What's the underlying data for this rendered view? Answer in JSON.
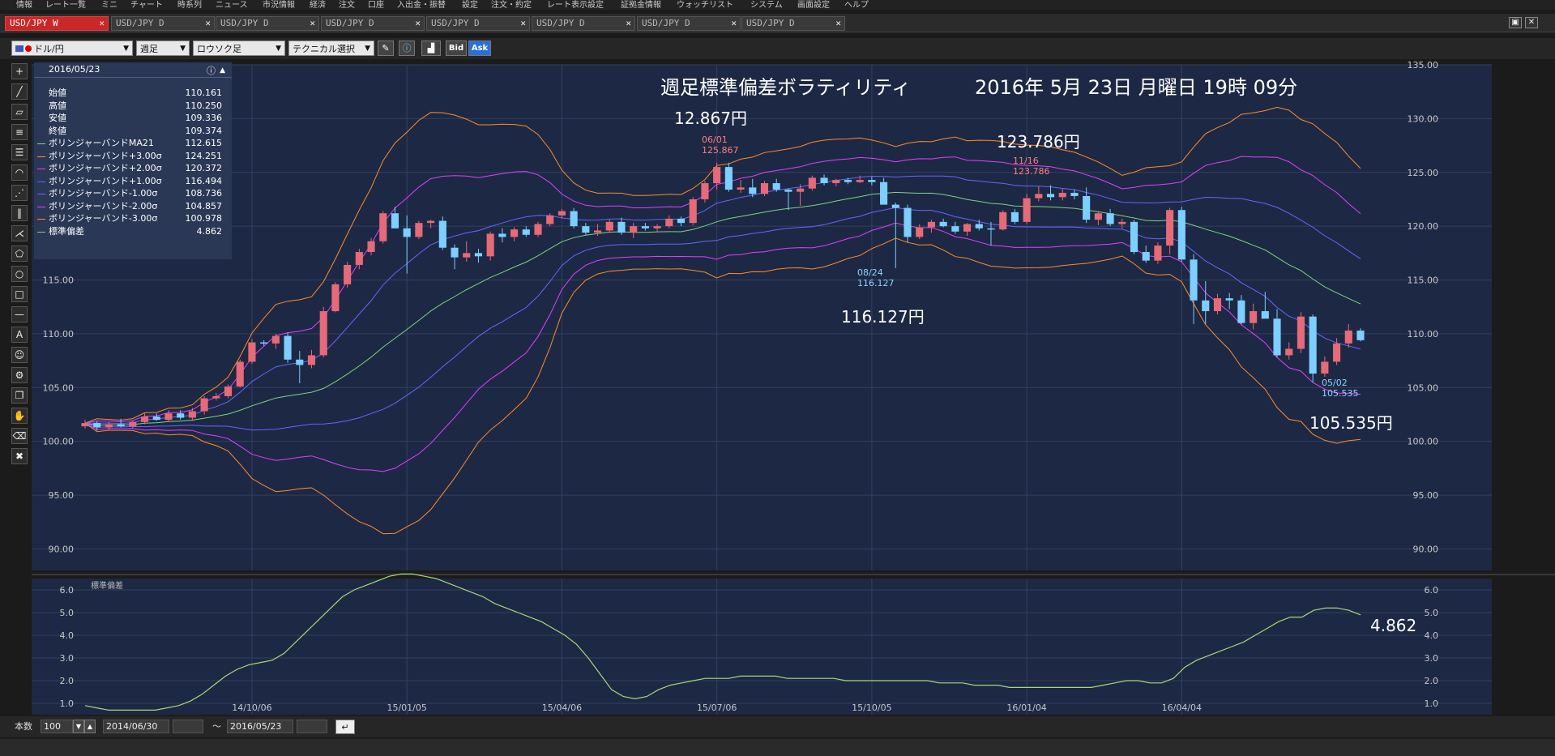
{
  "menu": [
    "情報",
    "レート一覧",
    "ミニ",
    "チャート",
    "時系列",
    "ニュース",
    "市況情報",
    "経済",
    "注文",
    "口座",
    "入出金・振替",
    "設定",
    "注文・約定",
    "レート表示設定",
    "証拠金情報",
    "ウォッチリスト",
    "システム",
    "画面設定",
    "ヘルプ"
  ],
  "tabs": [
    {
      "label": "USD/JPY W",
      "active": true
    },
    {
      "label": "USD/JPY D"
    },
    {
      "label": "USD/JPY D"
    },
    {
      "label": "USD/JPY D"
    },
    {
      "label": "USD/JPY D"
    },
    {
      "label": "USD/JPY D"
    },
    {
      "label": "USD/JPY D"
    },
    {
      "label": "USD/JPY D"
    }
  ],
  "toolbar": {
    "currency": "ドル/円",
    "period": "週足",
    "chart_type": "ロウソク足",
    "technical": "テクニカル選択",
    "bid": "Bid",
    "ask": "Ask"
  },
  "info": {
    "date": "2016/05/23",
    "rows": [
      {
        "label": "始値",
        "value": "110.161",
        "color": ""
      },
      {
        "label": "高値",
        "value": "110.250",
        "color": ""
      },
      {
        "label": "安値",
        "value": "109.336",
        "color": ""
      },
      {
        "label": "終値",
        "value": "109.374",
        "color": ""
      },
      {
        "label": "ボリンジャーバンドMA21",
        "value": "112.615",
        "color": "#7dd47d"
      },
      {
        "label": "ボリンジャーバンド+3.00σ",
        "value": "124.251",
        "color": "#ff8c28"
      },
      {
        "label": "ボリンジャーバンド+2.00σ",
        "value": "120.372",
        "color": "#e040ff"
      },
      {
        "label": "ボリンジャーバンド+1.00σ",
        "value": "116.494",
        "color": "#6666ff"
      },
      {
        "label": "ボリンジャーバンド-1.00σ",
        "value": "108.736",
        "color": "#6666ff"
      },
      {
        "label": "ボリンジャーバンド-2.00σ",
        "value": "104.857",
        "color": "#e040ff"
      },
      {
        "label": "ボリンジャーバンド-3.00σ",
        "value": "100.978",
        "color": "#ff8c28"
      },
      {
        "label": "標準偏差",
        "value": "4.862",
        "color": "#aaaaaa"
      }
    ]
  },
  "annotations": {
    "title": "週足標準偏差ボラティリティ",
    "timestamp": "2016年 5月 23日 月曜日 19時 09分",
    "high1": "12.867円",
    "high1_date": "06/01",
    "high1_val": "125.867",
    "high2": "123.786円",
    "high2_date": "11/16",
    "high2_val": "123.786",
    "low1": "116.127円",
    "low1_date": "08/24",
    "low1_val": "116.127",
    "low2": "105.535円",
    "low2_date": "05/02",
    "low2_val": "105.535",
    "sd_last": "4.862",
    "sd_panel_label": "標準偏差"
  },
  "bottom": {
    "count_label": "本数",
    "count": "100",
    "from": "2014/06/30",
    "tilde": "〜",
    "to": "2016/05/23"
  },
  "chart_data": [
    {
      "type": "candlestick",
      "ylim": [
        88,
        135
      ],
      "y_ticks": [
        "135.00",
        "130.00",
        "125.00",
        "120.00",
        "115.00",
        "110.00",
        "105.00",
        "100.00",
        "95.00",
        "90.00"
      ],
      "x_ticks": [
        "14/10/06",
        "15/01/05",
        "15/04/06",
        "15/07/06",
        "15/10/05",
        "16/01/04",
        "16/04/04"
      ],
      "bullish_color": "#e66a78",
      "bearish_color": "#7ccfff",
      "candles": [
        [
          101.4,
          102.0,
          101.2,
          101.7
        ],
        [
          101.7,
          101.9,
          101.0,
          101.3
        ],
        [
          101.3,
          101.8,
          101.0,
          101.6
        ],
        [
          101.6,
          102.1,
          101.3,
          101.4
        ],
        [
          101.4,
          101.9,
          101.2,
          101.8
        ],
        [
          101.8,
          102.6,
          101.6,
          102.3
        ],
        [
          102.3,
          102.6,
          101.9,
          102.0
        ],
        [
          102.0,
          102.9,
          101.8,
          102.6
        ],
        [
          102.6,
          102.9,
          102.0,
          102.2
        ],
        [
          102.2,
          103.1,
          101.9,
          102.8
        ],
        [
          102.8,
          104.2,
          102.5,
          104.0
        ],
        [
          104.0,
          104.5,
          103.8,
          104.2
        ],
        [
          104.2,
          105.3,
          104.0,
          105.1
        ],
        [
          105.1,
          107.6,
          105.0,
          107.4
        ],
        [
          107.4,
          109.5,
          107.2,
          109.2
        ],
        [
          109.2,
          109.4,
          108.9,
          109.1
        ],
        [
          109.1,
          110.0,
          108.6,
          109.8
        ],
        [
          109.8,
          110.1,
          107.3,
          107.6
        ],
        [
          107.6,
          108.4,
          105.4,
          107.1
        ],
        [
          107.1,
          108.5,
          106.8,
          108.0
        ],
        [
          108.0,
          112.5,
          107.8,
          112.1
        ],
        [
          112.1,
          114.8,
          112.0,
          114.6
        ],
        [
          114.6,
          116.7,
          114.3,
          116.4
        ],
        [
          116.4,
          117.9,
          116.0,
          117.6
        ],
        [
          117.6,
          118.9,
          117.3,
          118.6
        ],
        [
          118.6,
          121.4,
          118.4,
          121.2
        ],
        [
          121.2,
          121.8,
          119.8,
          119.8
        ],
        [
          119.8,
          121.0,
          115.6,
          119.0
        ],
        [
          119.0,
          120.5,
          118.8,
          120.3
        ],
        [
          120.3,
          120.6,
          119.8,
          120.5
        ],
        [
          120.5,
          120.9,
          117.8,
          118.0
        ],
        [
          118.0,
          118.3,
          116.0,
          117.1
        ],
        [
          117.1,
          118.6,
          116.7,
          117.5
        ],
        [
          117.5,
          117.9,
          116.6,
          117.2
        ],
        [
          117.2,
          119.5,
          116.8,
          119.3
        ],
        [
          119.3,
          119.8,
          118.5,
          119.0
        ],
        [
          119.0,
          119.9,
          118.6,
          119.7
        ],
        [
          119.7,
          120.0,
          119.0,
          119.2
        ],
        [
          119.2,
          120.4,
          119.0,
          120.2
        ],
        [
          120.2,
          121.2,
          120.0,
          121.0
        ],
        [
          121.0,
          121.6,
          120.7,
          121.4
        ],
        [
          121.4,
          121.7,
          119.8,
          120.0
        ],
        [
          120.0,
          120.3,
          119.2,
          119.4
        ],
        [
          119.4,
          120.2,
          119.1,
          119.6
        ],
        [
          119.6,
          120.6,
          119.4,
          120.4
        ],
        [
          120.4,
          120.8,
          119.2,
          119.4
        ],
        [
          119.4,
          120.3,
          118.9,
          120.0
        ],
        [
          120.0,
          120.3,
          119.6,
          119.8
        ],
        [
          119.8,
          120.2,
          119.5,
          120.0
        ],
        [
          120.0,
          121.0,
          119.8,
          120.7
        ],
        [
          120.7,
          120.9,
          120.0,
          120.3
        ],
        [
          120.3,
          122.7,
          120.1,
          122.5
        ],
        [
          122.5,
          124.2,
          122.2,
          124.0
        ],
        [
          124.0,
          125.9,
          123.4,
          125.5
        ],
        [
          125.5,
          125.9,
          123.2,
          123.4
        ],
        [
          123.4,
          124.3,
          123.1,
          123.6
        ],
        [
          123.6,
          124.4,
          122.7,
          123.0
        ],
        [
          123.0,
          124.2,
          122.8,
          124.0
        ],
        [
          124.0,
          124.4,
          123.2,
          123.4
        ],
        [
          123.4,
          123.5,
          121.5,
          123.2
        ],
        [
          123.2,
          123.9,
          121.9,
          123.5
        ],
        [
          123.5,
          124.7,
          123.3,
          124.5
        ],
        [
          124.5,
          124.8,
          123.8,
          124.0
        ],
        [
          124.0,
          124.4,
          123.7,
          124.3
        ],
        [
          124.3,
          124.5,
          123.9,
          124.1
        ],
        [
          124.1,
          124.7,
          124.0,
          124.3
        ],
        [
          124.3,
          124.6,
          123.8,
          124.1
        ],
        [
          124.1,
          124.5,
          122.0,
          122.0
        ],
        [
          122.0,
          122.2,
          116.1,
          121.7
        ],
        [
          121.7,
          122.0,
          118.5,
          119.0
        ],
        [
          119.0,
          120.2,
          118.8,
          119.9
        ],
        [
          119.9,
          120.6,
          119.4,
          120.4
        ],
        [
          120.4,
          120.7,
          119.9,
          120.0
        ],
        [
          120.0,
          120.4,
          119.3,
          119.5
        ],
        [
          119.5,
          120.3,
          119.1,
          120.2
        ],
        [
          120.2,
          120.6,
          119.6,
          119.8
        ],
        [
          119.8,
          120.4,
          118.2,
          119.7
        ],
        [
          119.7,
          121.5,
          119.6,
          121.3
        ],
        [
          121.3,
          121.6,
          120.2,
          120.4
        ],
        [
          120.4,
          123.0,
          120.2,
          122.6
        ],
        [
          122.6,
          123.7,
          122.3,
          123.0
        ],
        [
          123.0,
          123.8,
          122.4,
          122.7
        ],
        [
          122.7,
          123.5,
          122.4,
          123.1
        ],
        [
          123.1,
          123.4,
          122.5,
          122.8
        ],
        [
          122.8,
          123.6,
          120.3,
          120.6
        ],
        [
          120.6,
          121.4,
          120.1,
          121.2
        ],
        [
          121.2,
          121.6,
          120.0,
          120.2
        ],
        [
          120.2,
          120.7,
          119.8,
          120.4
        ],
        [
          120.4,
          120.6,
          117.4,
          117.6
        ],
        [
          117.6,
          118.2,
          116.6,
          116.8
        ],
        [
          116.8,
          118.5,
          116.5,
          118.2
        ],
        [
          118.2,
          121.7,
          117.4,
          121.5
        ],
        [
          121.5,
          121.8,
          116.7,
          116.9
        ],
        [
          116.9,
          117.4,
          110.9,
          113.1
        ],
        [
          113.1,
          114.9,
          110.9,
          112.1
        ],
        [
          112.1,
          113.7,
          111.8,
          113.3
        ],
        [
          113.3,
          113.8,
          112.3,
          113.1
        ],
        [
          113.1,
          113.6,
          110.9,
          111.0
        ],
        [
          111.0,
          112.8,
          110.4,
          112.1
        ],
        [
          112.1,
          113.9,
          111.6,
          111.4
        ],
        [
          111.4,
          112.3,
          107.8,
          108.0
        ],
        [
          108.0,
          109.2,
          107.6,
          108.6
        ],
        [
          108.6,
          112.0,
          108.2,
          111.6
        ],
        [
          111.6,
          111.8,
          105.5,
          106.3
        ],
        [
          106.3,
          107.9,
          106.0,
          107.4
        ],
        [
          107.4,
          109.6,
          107.1,
          109.1
        ],
        [
          109.1,
          110.9,
          108.7,
          110.3
        ],
        [
          110.3,
          110.5,
          109.3,
          109.4
        ]
      ]
    },
    {
      "type": "line",
      "series_name": "標準偏差",
      "ylim": [
        0.5,
        6.5
      ],
      "y_ticks": [
        "6.0",
        "5.0",
        "4.0",
        "3.0",
        "2.0",
        "1.0"
      ],
      "values": [
        0.9,
        0.8,
        0.7,
        0.7,
        0.7,
        0.7,
        0.7,
        0.8,
        0.9,
        1.1,
        1.4,
        1.8,
        2.2,
        2.5,
        2.7,
        2.8,
        2.9,
        3.2,
        3.7,
        4.2,
        4.7,
        5.2,
        5.7,
        6.0,
        6.2,
        6.4,
        6.6,
        6.7,
        6.7,
        6.6,
        6.5,
        6.3,
        6.1,
        5.9,
        5.7,
        5.4,
        5.2,
        5.0,
        4.8,
        4.6,
        4.3,
        4.0,
        3.6,
        3.0,
        2.3,
        1.6,
        1.3,
        1.2,
        1.3,
        1.6,
        1.8,
        1.9,
        2.0,
        2.1,
        2.1,
        2.1,
        2.2,
        2.2,
        2.2,
        2.2,
        2.1,
        2.1,
        2.1,
        2.1,
        2.1,
        2.0,
        2.0,
        2.0,
        2.0,
        2.0,
        2.0,
        2.0,
        2.0,
        1.9,
        1.9,
        1.9,
        1.8,
        1.8,
        1.8,
        1.7,
        1.7,
        1.7,
        1.7,
        1.7,
        1.7,
        1.7,
        1.7,
        1.8,
        1.9,
        2.0,
        2.0,
        1.9,
        1.9,
        2.1,
        2.6,
        2.9,
        3.1,
        3.3,
        3.5,
        3.7,
        4.0,
        4.3,
        4.6,
        4.8,
        4.8,
        5.1,
        5.2,
        5.2,
        5.1,
        4.9
      ]
    }
  ]
}
